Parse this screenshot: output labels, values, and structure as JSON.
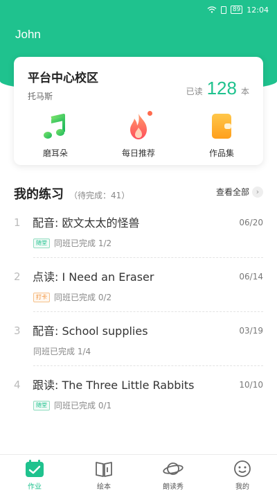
{
  "status_bar": {
    "time": "12:04",
    "battery": "89"
  },
  "user": {
    "name": "John"
  },
  "school": {
    "name": "平台中心校区",
    "sub": "托马斯",
    "read_label": "已读",
    "read_count": "128",
    "read_unit": "本"
  },
  "quick_actions": [
    {
      "label": "磨耳朵",
      "icon": "music-note-icon"
    },
    {
      "label": "每日推荐",
      "icon": "flame-icon"
    },
    {
      "label": "作品集",
      "icon": "wallet-icon"
    }
  ],
  "practice": {
    "title": "我的练习",
    "pending": "（待完成：41）",
    "view_all": "查看全部"
  },
  "tasks": [
    {
      "num": "1",
      "title": "配音: 欧文太太的怪兽",
      "date": "06/20",
      "tag": "随堂",
      "progress": "同班已完成 1/2"
    },
    {
      "num": "2",
      "title": "点读: I Need an Eraser",
      "date": "06/14",
      "tag": "打卡",
      "progress": "同班已完成 0/2"
    },
    {
      "num": "3",
      "title": "配音: School supplies",
      "date": "03/19",
      "tag": "",
      "progress": "同班已完成 1/4"
    },
    {
      "num": "4",
      "title": "跟读: The Three Little Rabbits",
      "date": "10/10",
      "tag": "随堂",
      "progress": "同班已完成 0/1"
    }
  ],
  "tabs": [
    {
      "label": "作业",
      "icon": "homework-calendar-icon",
      "active": true
    },
    {
      "label": "绘本",
      "icon": "book-icon",
      "active": false
    },
    {
      "label": "朗读秀",
      "icon": "planet-icon",
      "active": false
    },
    {
      "label": "我的",
      "icon": "smiley-icon",
      "active": false
    }
  ],
  "colors": {
    "accent": "#1fc28e",
    "tag_orange": "#f08a2c",
    "dot": "#ff6b4e"
  }
}
